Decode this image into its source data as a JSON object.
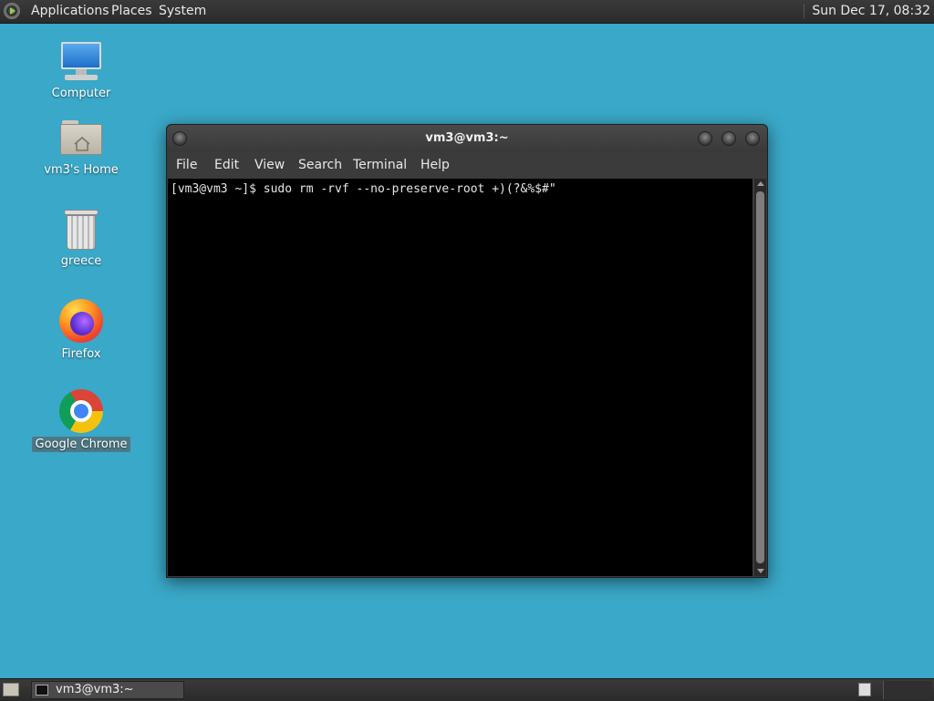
{
  "top_panel": {
    "menus": [
      "Applications",
      "Places",
      "System"
    ],
    "clock": "Sun Dec 17, 08:32"
  },
  "desktop_icons": [
    {
      "label": "Computer",
      "icon": "computer-icon"
    },
    {
      "label": "vm3's Home",
      "icon": "home-folder-icon"
    },
    {
      "label": "greece",
      "icon": "trash-icon"
    },
    {
      "label": "Firefox",
      "icon": "firefox-icon"
    },
    {
      "label": "Google Chrome",
      "icon": "chrome-icon",
      "selected": true
    }
  ],
  "terminal": {
    "title": "vm3@vm3:~",
    "menu": [
      "File",
      "Edit",
      "View",
      "Search",
      "Terminal",
      "Help"
    ],
    "lines": [
      "[vm3@vm3 ~]$ sudo rm -rvf --no-preserve-root +)(?&%$#\""
    ]
  },
  "bottom_panel": {
    "tasks": [
      {
        "label": "vm3@vm3:~",
        "icon": "terminal-icon"
      }
    ]
  },
  "colors": {
    "desktop": "#3aa8c8",
    "panel": "#2f2f2f",
    "terminal_bg": "#000000",
    "terminal_fg": "#e6e6e6"
  }
}
